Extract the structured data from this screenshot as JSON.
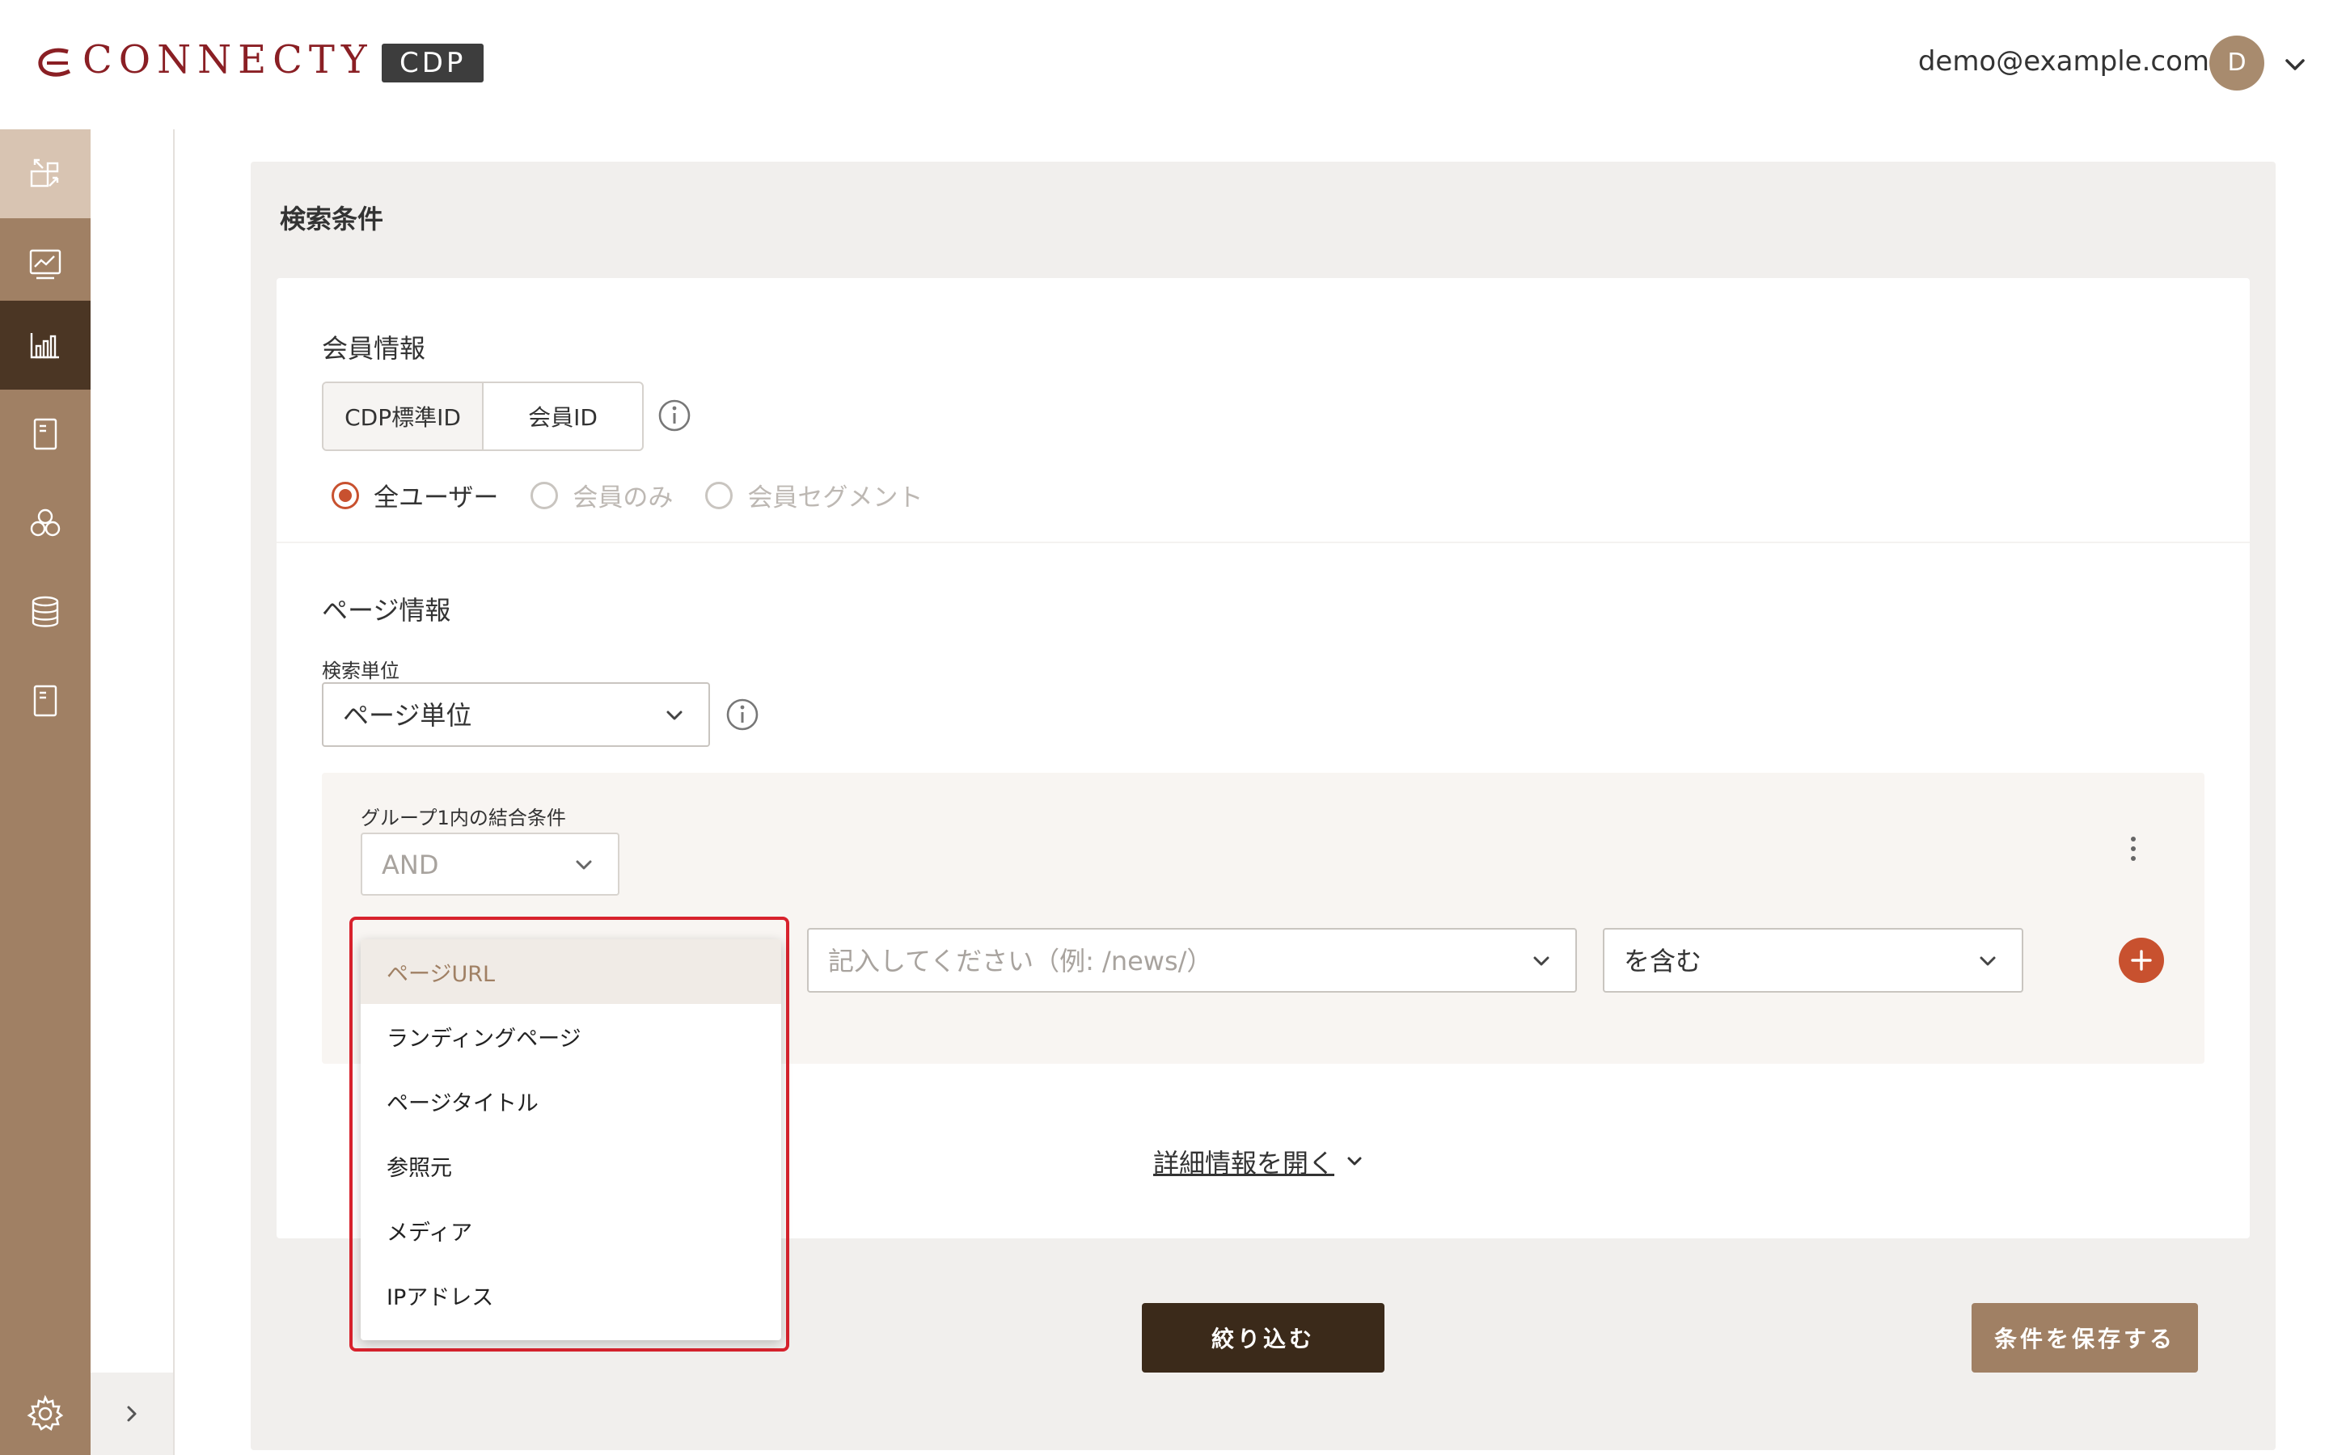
{
  "header": {
    "logo_text": "CONNECTY",
    "logo_badge": "CDP",
    "user_email": "demo@example.com",
    "avatar_initial": "D"
  },
  "sidebar": {
    "items": [
      {
        "icon": "transfer-icon",
        "state": "light"
      },
      {
        "icon": "monitor-chart-icon",
        "state": "normal"
      },
      {
        "icon": "bar-chart-icon",
        "state": "active"
      },
      {
        "icon": "document-icon",
        "state": "normal"
      },
      {
        "icon": "segment-circles-icon",
        "state": "normal"
      },
      {
        "icon": "database-icon",
        "state": "normal"
      },
      {
        "icon": "document-icon",
        "state": "normal"
      }
    ],
    "footer_icon": "gear-icon",
    "expand_icon": "chevron-right-icon"
  },
  "search": {
    "title": "検索条件",
    "member": {
      "title": "会員情報",
      "id_toggle": [
        "CDP標準ID",
        "会員ID"
      ],
      "radios": [
        {
          "label": "全ユーザー",
          "checked": true
        },
        {
          "label": "会員のみ",
          "checked": false
        },
        {
          "label": "会員セグメント",
          "checked": false
        }
      ]
    },
    "page": {
      "title": "ページ情報",
      "unit_label": "検索単位",
      "unit_value": "ページ単位",
      "group": {
        "join_label": "グループ1内の結合条件",
        "join_value": "AND",
        "value_placeholder": "記入してください（例: /news/）",
        "operator_value": "を含む"
      },
      "dropdown_options": [
        "ページURL",
        "ランディングページ",
        "ページタイトル",
        "参照元",
        "メディア",
        "IPアドレス"
      ],
      "dropdown_selected": "ページURL"
    },
    "details_link": "詳細情報を開く",
    "filter_button": "絞り込む",
    "save_button": "条件を保存する"
  },
  "colors": {
    "brand": "#8a1f24",
    "sidebar": "#a08064",
    "sidebar_active": "#4b3624",
    "accent": "#c8512f",
    "primary_button": "#3b2a1a",
    "highlight": "#d8222d"
  }
}
